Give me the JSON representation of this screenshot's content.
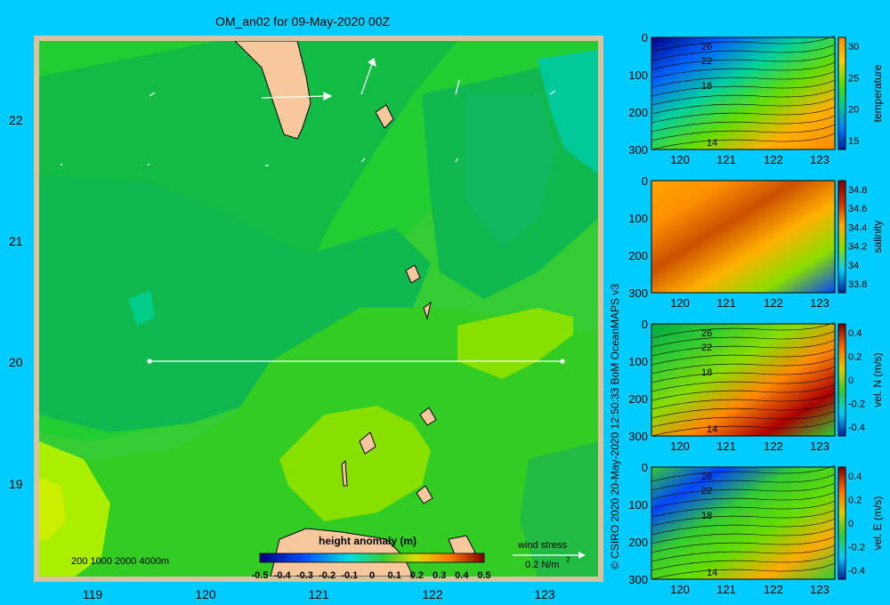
{
  "title": "OM_an02 for 09-May-2020 00Z",
  "map": {
    "lat_ticks": [
      "22",
      "21",
      "20",
      "19"
    ],
    "lon_ticks": [
      "119",
      "120",
      "121",
      "122",
      "123"
    ],
    "depth_legend": "200  1000  2000  4000m",
    "colorbar_title": "height anomaly  (m)",
    "colorbar_ticks": [
      "-0.5",
      "-0.4",
      "-0.3",
      "-0.2",
      "-0.1",
      "0",
      "0.1",
      "0.2",
      "0.3",
      "0.4",
      "0.5"
    ],
    "wind_label": "wind stress",
    "wind_scale": "0.2 N/m",
    "wind_scale_sup": "2",
    "colors": {
      "frame": "#d8c4a2",
      "land": "#f7c89b",
      "background": "#00ccff"
    }
  },
  "panels": [
    {
      "variable": "temperature",
      "y_ticks": [
        "0",
        "100",
        "200",
        "300"
      ],
      "x_ticks": [
        "120",
        "121",
        "122",
        "123"
      ],
      "cb_ticks": [
        "30",
        "25",
        "20",
        "15"
      ],
      "contour_labels": [
        "26",
        "22",
        "18",
        "14"
      ]
    },
    {
      "variable": "salinity",
      "y_ticks": [
        "0",
        "100",
        "200",
        "300"
      ],
      "x_ticks": [
        "120",
        "121",
        "122",
        "123"
      ],
      "cb_ticks": [
        "34.8",
        "34.6",
        "34.4",
        "34.2",
        "34",
        "33.8"
      ],
      "contour_labels": []
    },
    {
      "variable": "vel. N  (m/s)",
      "y_ticks": [
        "0",
        "100",
        "200",
        "300"
      ],
      "x_ticks": [
        "120",
        "121",
        "122",
        "123"
      ],
      "cb_ticks": [
        "0.4",
        "0.2",
        "0",
        "-0.2",
        "-0.4"
      ],
      "contour_labels": [
        "26",
        "22",
        "18",
        "14"
      ]
    },
    {
      "variable": "vel. E  (m/s)",
      "y_ticks": [
        "0",
        "100",
        "200",
        "300"
      ],
      "x_ticks": [
        "120",
        "121",
        "122",
        "123"
      ],
      "cb_ticks": [
        "0.4",
        "0.2",
        "0",
        "-0.2",
        "-0.4"
      ],
      "contour_labels": [
        "26",
        "22",
        "18",
        "14"
      ]
    }
  ],
  "copyright": "© CSIRO 2020   20-May-2020 12:50:33 BoM OceanMAPS v3"
}
